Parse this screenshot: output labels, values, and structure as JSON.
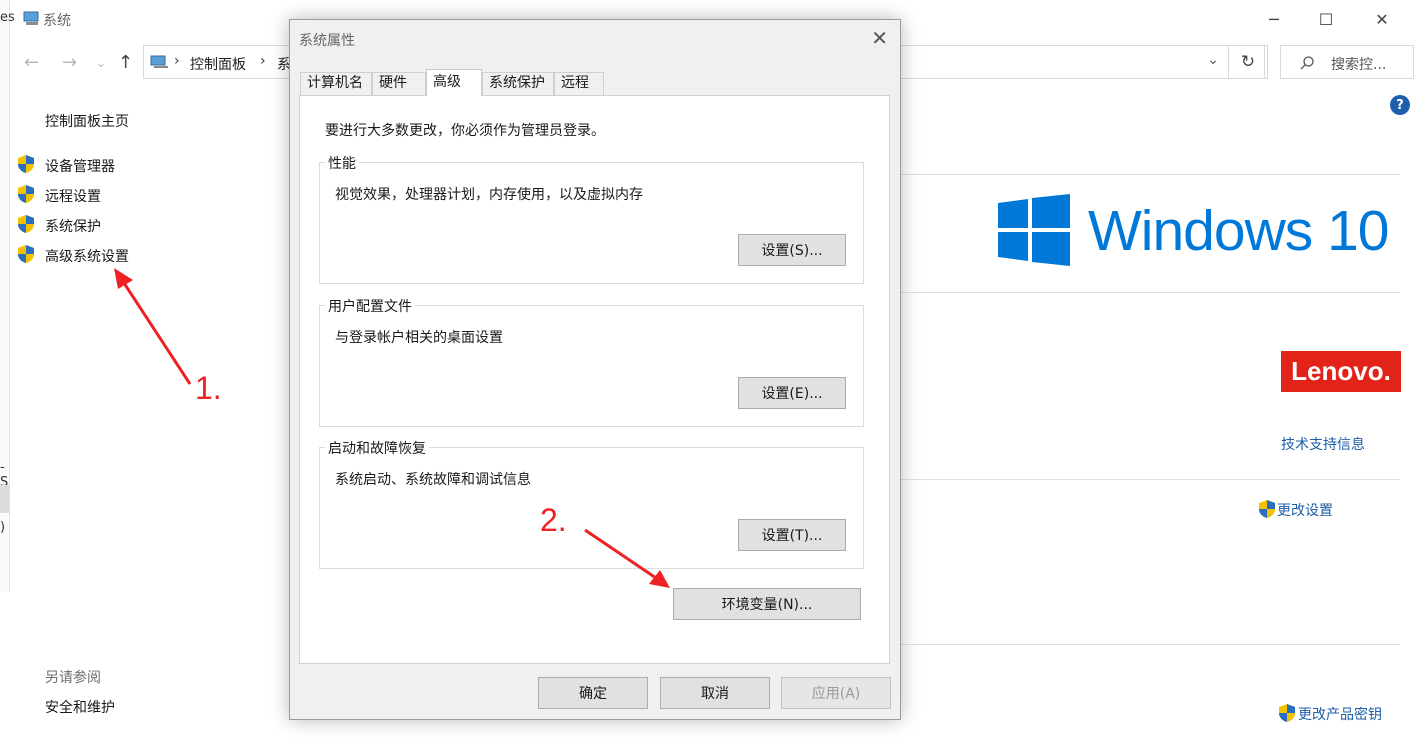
{
  "window": {
    "title": "系统",
    "left_stub_1": "es",
    "left_stub_2": "-S",
    "left_stub_3": ")"
  },
  "address": {
    "crumbs": [
      "控制面板",
      "系"
    ],
    "search_placeholder": "搜索控..."
  },
  "sidebar": {
    "home": "控制面板主页",
    "items": [
      {
        "label": "设备管理器",
        "icon": "uac-shield-icon"
      },
      {
        "label": "远程设置",
        "icon": "uac-shield-icon"
      },
      {
        "label": "系统保护",
        "icon": "uac-shield-icon"
      },
      {
        "label": "高级系统设置",
        "icon": "uac-shield-icon"
      }
    ],
    "see_also_title": "另请参阅",
    "see_also_items": [
      "安全和维护"
    ]
  },
  "right": {
    "windows_brand": "Windows 10",
    "oem_brand": "Lenovo.",
    "support_link": "技术支持信息",
    "change_settings": "更改设置",
    "change_key": "更改产品密钥"
  },
  "dialog": {
    "title": "系统属性",
    "tabs": [
      "计算机名",
      "硬件",
      "高级",
      "系统保护",
      "远程"
    ],
    "active_tab": "高级",
    "notice": "要进行大多数更改，你必须作为管理员登录。",
    "groups": [
      {
        "legend": "性能",
        "desc": "视觉效果，处理器计划，内存使用，以及虚拟内存",
        "button": "设置(S)..."
      },
      {
        "legend": "用户配置文件",
        "desc": "与登录帐户相关的桌面设置",
        "button": "设置(E)..."
      },
      {
        "legend": "启动和故障恢复",
        "desc": "系统启动、系统故障和调试信息",
        "button": "设置(T)..."
      }
    ],
    "env_button": "环境变量(N)...",
    "ok": "确定",
    "cancel": "取消",
    "apply": "应用(A)"
  },
  "annotations": {
    "step1": "1.",
    "step2": "2.",
    "color": "#ee2222"
  }
}
